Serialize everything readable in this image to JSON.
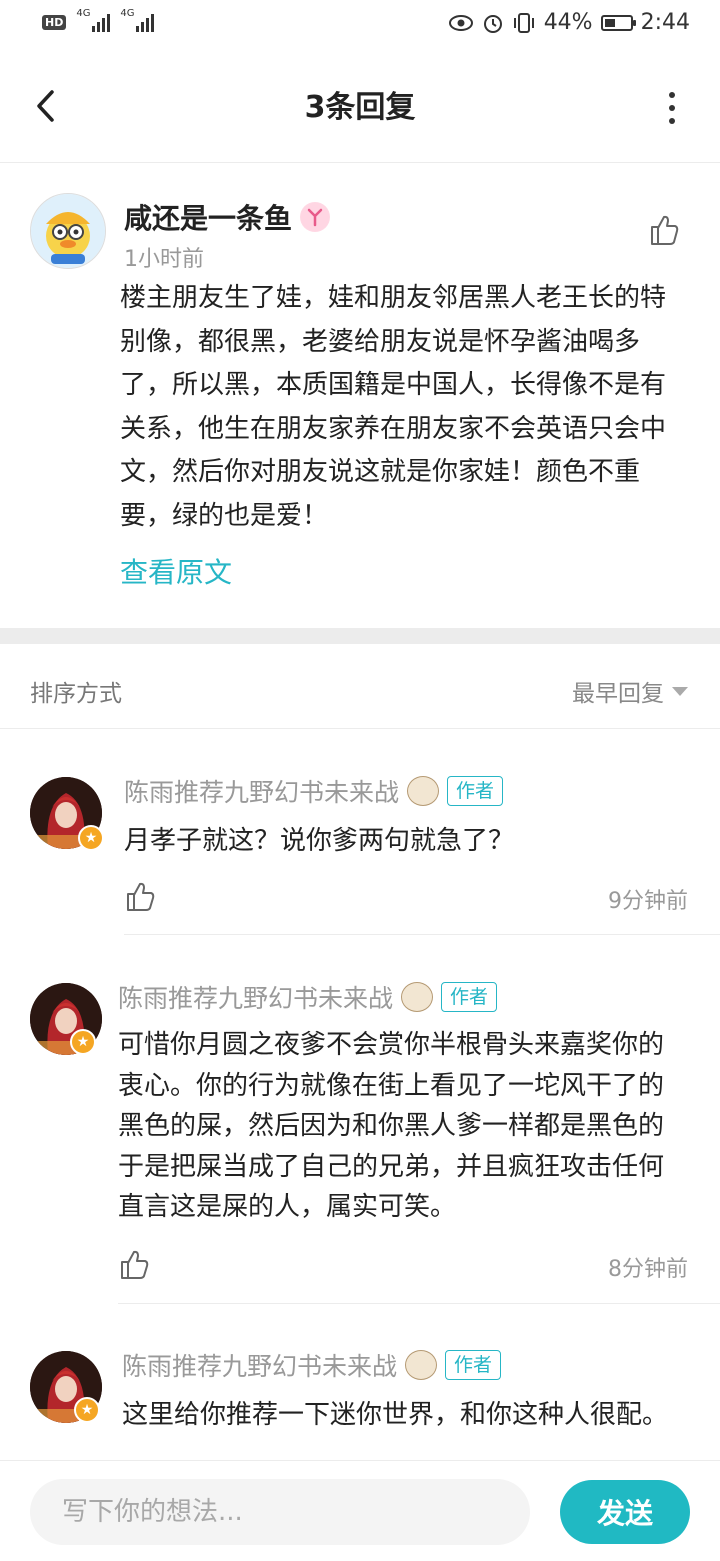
{
  "status_bar": {
    "hd": "HD",
    "sim1": "4G",
    "sim2": "4G",
    "battery_percent": "44%",
    "battery_level": 0.44,
    "time": "2:44",
    "icons": [
      "eye-icon",
      "alarm-icon",
      "vibrate-icon",
      "battery-icon"
    ]
  },
  "header": {
    "title": "3条回复"
  },
  "main_comment": {
    "username": "咸还是一条鱼",
    "time": "1小时前",
    "body": "楼主朋友生了娃，娃和朋友邻居黑人老王长的特别像，都很黑，老婆给朋友说是怀孕酱油喝多了，所以黑，本质国籍是中国人，长得像不是有关系，他生在朋友家养在朋友家不会英语只会中文，然后你对朋友说这就是你家娃！颜色不重要，绿的也是爱！",
    "view_original": "查看原文"
  },
  "sort": {
    "label": "排序方式",
    "value": "最早回复"
  },
  "replies": [
    {
      "username": "陈雨推荐九野幻书未来战",
      "tag": "作者",
      "body": "月孝子就这？说你爹两句就急了？",
      "time": "9分钟前"
    },
    {
      "username": "陈雨推荐九野幻书未来战",
      "tag": "作者",
      "body": "可惜你月圆之夜爹不会赏你半根骨头来嘉奖你的衷心。你的行为就像在街上看见了一坨风干了的黑色的屎，然后因为和你黑人爹一样都是黑色的于是把屎当成了自己的兄弟，并且疯狂攻击任何直言这是屎的人，属实可笑。",
      "time": "8分钟前"
    },
    {
      "username": "陈雨推荐九野幻书未来战",
      "tag": "作者",
      "body": "这里给你推荐一下迷你世界，和你这种人很配。",
      "time": ""
    }
  ],
  "bottom": {
    "placeholder": "写下你的想法...",
    "send_label": "发送"
  },
  "colors": {
    "accent": "#26b6c6",
    "send_button": "#20b9c3",
    "badge": "#f5a623"
  }
}
